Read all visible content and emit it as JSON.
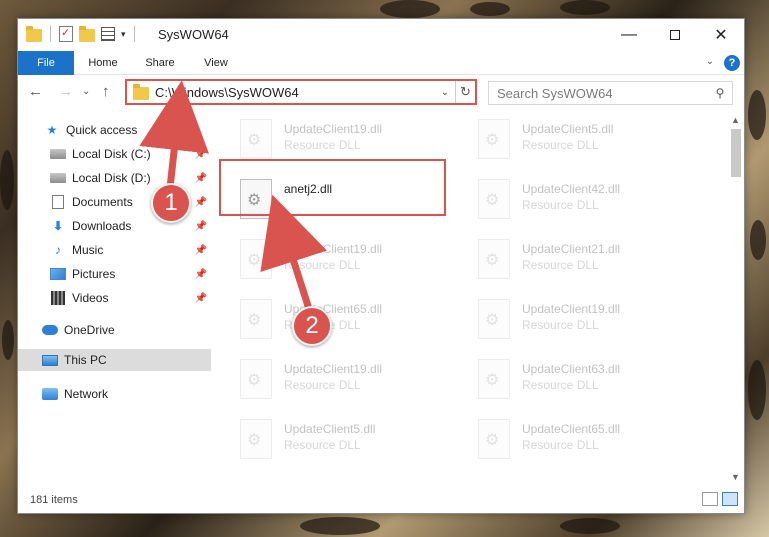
{
  "window": {
    "title": "SysWOW64"
  },
  "ribbon": {
    "tabs": [
      "File",
      "Home",
      "Share",
      "View"
    ]
  },
  "address": {
    "path": "C:\\Windows\\SysWOW64"
  },
  "search": {
    "placeholder": "Search SysWOW64"
  },
  "nav": {
    "items": [
      {
        "label": "Quick access"
      },
      {
        "label": "Local Disk (C:)"
      },
      {
        "label": "Local Disk (D:)"
      },
      {
        "label": "Documents"
      },
      {
        "label": "Downloads"
      },
      {
        "label": "Music"
      },
      {
        "label": "Pictures"
      },
      {
        "label": "Videos"
      },
      {
        "label": "OneDrive"
      },
      {
        "label": "This PC"
      },
      {
        "label": "Network"
      }
    ]
  },
  "files": {
    "left": [
      {
        "name": "UpdateClient19.dll",
        "type": "Resource DLL"
      },
      {
        "name": "anetj2.dll",
        "type": ""
      },
      {
        "name": "UpdateClient19.dll",
        "type": "Resource DLL"
      },
      {
        "name": "UpdateClient65.dll",
        "type": "Resource DLL"
      },
      {
        "name": "UpdateClient19.dll",
        "type": "Resource DLL"
      },
      {
        "name": "UpdateClient5.dll",
        "type": "Resource DLL"
      }
    ],
    "right": [
      {
        "name": "UpdateClient5.dll",
        "type": "Resource DLL"
      },
      {
        "name": "UpdateClient42.dll",
        "type": "Resource DLL"
      },
      {
        "name": "UpdateClient21.dll",
        "type": "Resource DLL"
      },
      {
        "name": "UpdateClient19.dll",
        "type": "Resource DLL"
      },
      {
        "name": "UpdateClient63.dll",
        "type": "Resource DLL"
      },
      {
        "name": "UpdateClient65.dll",
        "type": "Resource DLL"
      }
    ]
  },
  "status": {
    "count": "181 items"
  },
  "annotations": {
    "badge1": "1",
    "badge2": "2",
    "color": "#d9534f"
  }
}
